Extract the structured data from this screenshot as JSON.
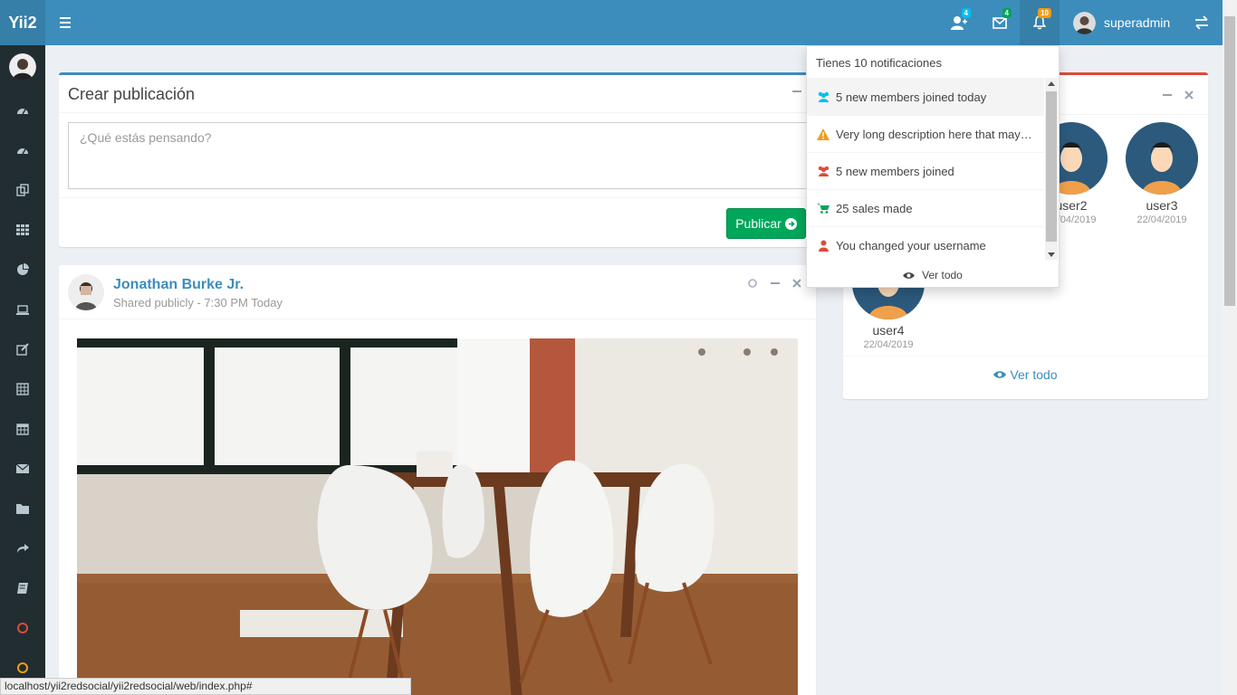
{
  "header": {
    "logo": "Yii2",
    "badges": {
      "friends": "4",
      "messages": "4",
      "notifications": "10"
    },
    "username": "superadmin"
  },
  "create_post": {
    "title": "Crear publicación",
    "placeholder": "¿Qué estás pensando?",
    "publish_label": "Publicar"
  },
  "post": {
    "author": "Jonathan Burke Jr.",
    "description": "Shared publicly - 7:30 PM Today"
  },
  "users_box": {
    "users": [
      {
        "name": "user2",
        "date": "22/04/2019"
      },
      {
        "name": "user3",
        "date": "22/04/2019"
      },
      {
        "name": "user4",
        "date": "22/04/2019"
      }
    ],
    "view_all": "Ver todo"
  },
  "notifications": {
    "header": "Tienes 10 notificaciones",
    "items": [
      {
        "text": "5 new members joined today",
        "icon": "users-icon",
        "color": "#00c0ef"
      },
      {
        "text": "Very long description here that may not fit into the page",
        "icon": "warning-icon",
        "color": "#f39c12"
      },
      {
        "text": "5 new members joined",
        "icon": "users-icon",
        "color": "#dd4b39"
      },
      {
        "text": "25 sales made",
        "icon": "cart-icon",
        "color": "#00a65a"
      },
      {
        "text": "You changed your username",
        "icon": "user-icon",
        "color": "#dd4b39"
      }
    ],
    "footer": "Ver todo"
  },
  "status_url": "localhost/yii2redsocial/yii2redsocial/web/index.php#",
  "colors": {
    "header": "#3c8dbc",
    "sidebar": "#222d32",
    "success": "#00a65a"
  }
}
